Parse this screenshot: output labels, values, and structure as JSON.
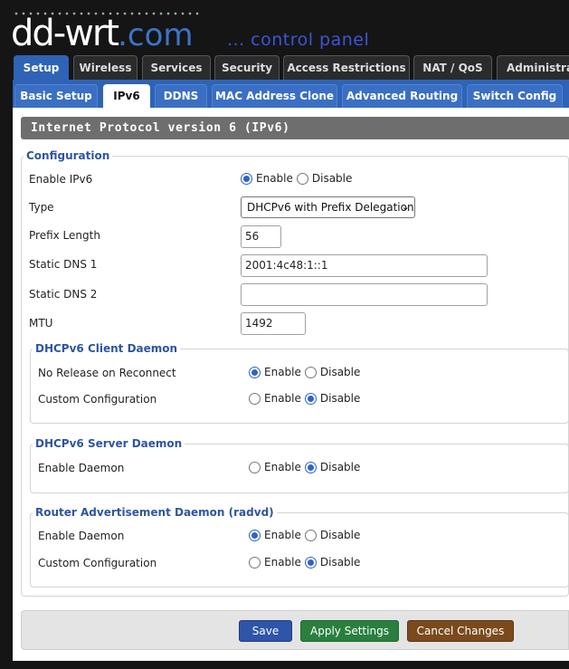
{
  "header": {
    "logo_main": "dd-wrt",
    "logo_domain": ".com",
    "tagline": "... control panel"
  },
  "main_tabs": [
    {
      "label": "Setup",
      "active": true
    },
    {
      "label": "Wireless",
      "active": false
    },
    {
      "label": "Services",
      "active": false
    },
    {
      "label": "Security",
      "active": false
    },
    {
      "label": "Access Restrictions",
      "active": false
    },
    {
      "label": "NAT / QoS",
      "active": false
    },
    {
      "label": "Administrati",
      "active": false
    }
  ],
  "sub_tabs": [
    {
      "label": "Basic Setup",
      "active": false
    },
    {
      "label": "IPv6",
      "active": true
    },
    {
      "label": "DDNS",
      "active": false
    },
    {
      "label": "MAC Address Clone",
      "active": false
    },
    {
      "label": "Advanced Routing",
      "active": false
    },
    {
      "label": "Switch Config",
      "active": false
    }
  ],
  "page_title": "Internet Protocol version 6 (IPv6)",
  "configuration": {
    "legend": "Configuration",
    "enable_ipv6": {
      "label": "Enable IPv6",
      "enable": "Enable",
      "disable": "Disable",
      "value": "Enable"
    },
    "type": {
      "label": "Type",
      "value": "DHCPv6 with Prefix Delegation"
    },
    "prefix_length": {
      "label": "Prefix Length",
      "value": "56"
    },
    "static_dns1": {
      "label": "Static DNS 1",
      "value": "2001:4c48:1::1"
    },
    "static_dns2": {
      "label": "Static DNS 2",
      "value": ""
    },
    "mtu": {
      "label": "MTU",
      "value": "1492"
    }
  },
  "dhcpv6_client": {
    "legend": "DHCPv6 Client Daemon",
    "no_release": {
      "label": "No Release on Reconnect",
      "enable": "Enable",
      "disable": "Disable",
      "value": "Enable"
    },
    "custom_config": {
      "label": "Custom Configuration",
      "enable": "Enable",
      "disable": "Disable",
      "value": "Disable"
    }
  },
  "dhcpv6_server": {
    "legend": "DHCPv6 Server Daemon",
    "enable_daemon": {
      "label": "Enable Daemon",
      "enable": "Enable",
      "disable": "Disable",
      "value": "Disable"
    }
  },
  "radvd": {
    "legend": "Router Advertisement Daemon (radvd)",
    "enable_daemon": {
      "label": "Enable Daemon",
      "enable": "Enable",
      "disable": "Disable",
      "value": "Enable"
    },
    "custom_config": {
      "label": "Custom Configuration",
      "enable": "Enable",
      "disable": "Disable",
      "value": "Disable"
    }
  },
  "buttons": {
    "save": "Save",
    "apply": "Apply Settings",
    "cancel": "Cancel Changes"
  },
  "colors": {
    "accent": "#2f63b5",
    "save": "#2e55a8",
    "apply": "#2a7f3f",
    "cancel": "#7b4a1c"
  }
}
